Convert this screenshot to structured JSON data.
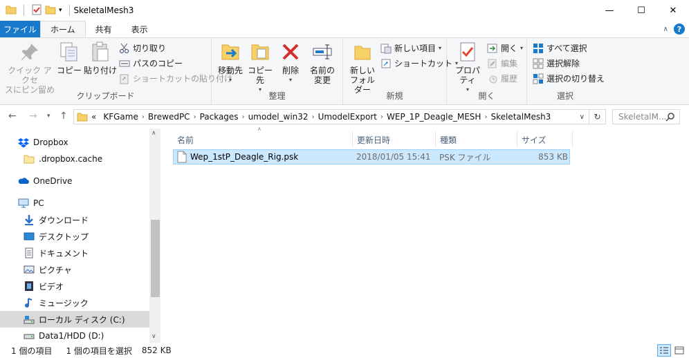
{
  "window": {
    "title": "SkeletalMesh3",
    "controls": {
      "minimize": "—",
      "maximize": "☐",
      "close": "✕"
    }
  },
  "tabs": [
    {
      "label": "ファイル"
    },
    {
      "label": "ホーム"
    },
    {
      "label": "共有"
    },
    {
      "label": "表示"
    }
  ],
  "ribbon": {
    "clipboard": {
      "label": "クリップボード",
      "pin_line1": "クイック アクセ",
      "pin_line2": "スにピン留め",
      "copy": "コピー",
      "paste": "貼り付け",
      "cut": "切り取り",
      "copy_path": "パスのコピー",
      "paste_shortcut": "ショートカットの貼り付け"
    },
    "organize": {
      "label": "整理",
      "move_to": "移動先",
      "copy_to": "コピー先",
      "delete": "削除",
      "rename_line1": "名前の",
      "rename_line2": "変更"
    },
    "new": {
      "label": "新規",
      "new_folder_line1": "新しい",
      "new_folder_line2": "フォルダー",
      "new_item": "新しい項目",
      "shortcut": "ショートカット"
    },
    "open": {
      "label": "開く",
      "properties": "プロパティ",
      "open": "開く",
      "edit": "編集",
      "history": "履歴"
    },
    "select": {
      "label": "選択",
      "select_all": "すべて選択",
      "select_none": "選択解除",
      "invert": "選択の切り替え"
    }
  },
  "address": {
    "prefix": "«",
    "crumbs": [
      "KFGame",
      "BrewedPC",
      "Packages",
      "umodel_win32",
      "UmodelExport",
      "WEP_1P_Deagle_MESH",
      "SkeletalMesh3"
    ],
    "search_placeholder": "SkeletalM..."
  },
  "nav": [
    {
      "label": "Dropbox",
      "icon": "dropbox-icon"
    },
    {
      "label": ".dropbox.cache",
      "icon": "folder-icon"
    },
    {
      "label": "OneDrive",
      "icon": "onedrive-icon"
    },
    {
      "label": "PC",
      "icon": "pc-icon"
    },
    {
      "label": "ダウンロード",
      "icon": "download-icon"
    },
    {
      "label": "デスクトップ",
      "icon": "desktop-icon"
    },
    {
      "label": "ドキュメント",
      "icon": "documents-icon"
    },
    {
      "label": "ピクチャ",
      "icon": "pictures-icon"
    },
    {
      "label": "ビデオ",
      "icon": "videos-icon"
    },
    {
      "label": "ミュージック",
      "icon": "music-icon"
    },
    {
      "label": "ローカル ディスク (C:)",
      "icon": "drive-icon"
    },
    {
      "label": "Data1/HDD (D:)",
      "icon": "drive-icon"
    }
  ],
  "columns": {
    "name": "名前",
    "modified": "更新日時",
    "type": "種類",
    "size": "サイズ"
  },
  "files": [
    {
      "name": "Wep_1stP_Deagle_Rig.psk",
      "modified": "2018/01/05 15:41",
      "type": "PSK ファイル",
      "size": "853 KB"
    }
  ],
  "status": {
    "count": "1 個の項目",
    "selected": "1 個の項目を選択",
    "selected_size": "852 KB"
  },
  "colors": {
    "accent": "#1979ca",
    "selection": "#cce8ff",
    "selection_border": "#99d1ff"
  }
}
